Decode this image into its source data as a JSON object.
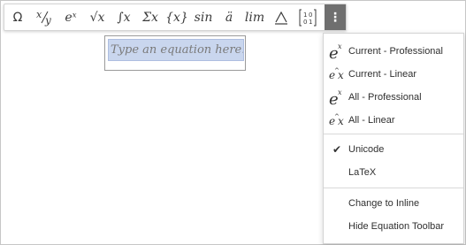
{
  "toolbar": {
    "buttons": [
      {
        "name": "omega-symbols-button",
        "label": "Ω",
        "plain": true
      },
      {
        "name": "fraction-button",
        "label": "x⁄y",
        "plain": false
      },
      {
        "name": "exponent-button",
        "label": "eˣ",
        "plain": false
      },
      {
        "name": "radical-button",
        "label": "√x",
        "plain": false
      },
      {
        "name": "integral-button",
        "label": "∫x",
        "plain": false
      },
      {
        "name": "sum-button",
        "label": "Σx",
        "plain": false
      },
      {
        "name": "brackets-button",
        "label": "{x}",
        "plain": false
      },
      {
        "name": "function-button",
        "label": "sin",
        "plain": false
      },
      {
        "name": "accent-button",
        "label": "ä",
        "plain": false
      },
      {
        "name": "limit-button",
        "label": "lim",
        "plain": false
      },
      {
        "name": "operator-button",
        "label": "⩝",
        "plain": true
      },
      {
        "name": "matrix-button",
        "label": "[1 0 / 0 1]",
        "plain": true
      }
    ],
    "more_label": "⋮"
  },
  "equation": {
    "placeholder_text": "Type an equation here."
  },
  "menu": {
    "format_items": [
      {
        "label": "Current - Professional",
        "icon": "professional-format-icon"
      },
      {
        "label": "Current - Linear",
        "icon": "linear-format-icon"
      },
      {
        "label": "All - Professional",
        "icon": "professional-format-icon"
      },
      {
        "label": "All - Linear",
        "icon": "linear-format-icon"
      }
    ],
    "input_items": [
      {
        "label": "Unicode",
        "checked": true
      },
      {
        "label": "LaTeX",
        "checked": false
      }
    ],
    "action_items": [
      {
        "label": "Change to Inline"
      },
      {
        "label": "Hide Equation Toolbar"
      }
    ]
  }
}
